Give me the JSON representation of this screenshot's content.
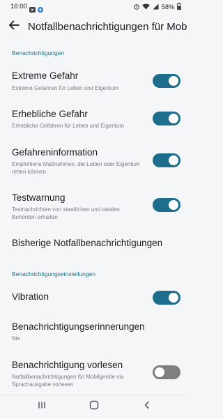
{
  "status_bar": {
    "time": "16:00",
    "battery": "58%"
  },
  "header": {
    "title": "Notfallbenachrichtigungen für Mobilgeräte"
  },
  "sections": [
    {
      "header": "Benachrichtigungen"
    },
    {
      "header": "Benachrichtigungseinstellungen"
    }
  ],
  "items": [
    {
      "title": "Extreme Gefahr",
      "subtitle": "Extreme Gefahren für Leben und Eigentum",
      "toggle": true
    },
    {
      "title": "Erhebliche Gefahr",
      "subtitle": "Erhebliche Gefahren für Leben und Eigentum",
      "toggle": true
    },
    {
      "title": "Gefahreninformation",
      "subtitle": "Empfohlene Maßnahmen, die Leben oder Eigentum retten können",
      "toggle": true
    },
    {
      "title": "Testwarnung",
      "subtitle": "Testnachrichten von staatlichen und lokalen Behörden erhalten",
      "toggle": true
    },
    {
      "title": "Bisherige Notfallbenachrichtigungen"
    },
    {
      "title": "Vibration",
      "toggle": true
    },
    {
      "title": "Benachrichtigungserinnerungen",
      "subtitle": "Nie"
    },
    {
      "title": "Benachrichtigung vorlesen",
      "subtitle": "Notfallbenachrichtigungen für Mobilgeräte via Sprachausgabe vorlesen",
      "toggle": false
    }
  ],
  "icons": {
    "back": "arrow-left-icon",
    "recents": "recents-icon",
    "home": "home-icon",
    "nav_back": "chevron-left-icon"
  },
  "colors": {
    "accent": "#1c6e8c",
    "section_header": "#1f6e88",
    "toggle_off": "#7f7f7f"
  }
}
